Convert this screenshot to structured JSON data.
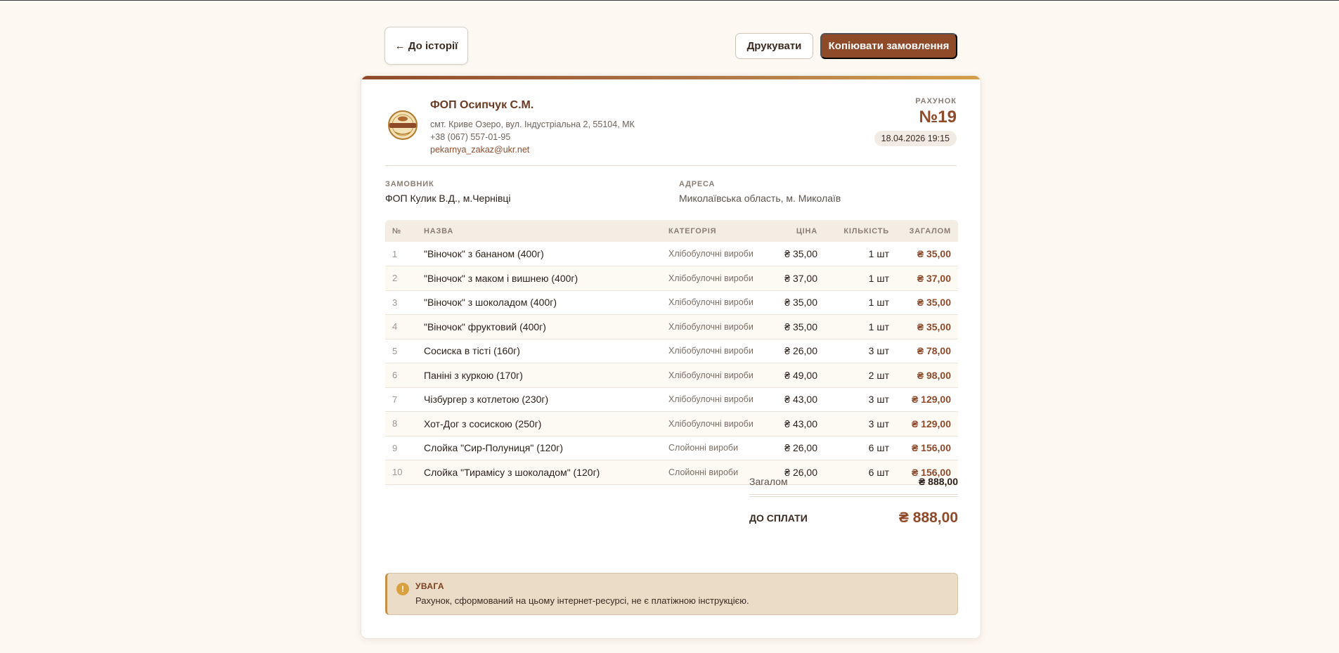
{
  "toolbar": {
    "back_label": "← До історії",
    "print_label": "Друкувати",
    "copy_label": "Копіювати замовлення"
  },
  "seller": {
    "name": "ФОП Осипчук С.М.",
    "address": "смт. Криве Озеро, вул. Індустріальна 2, 55104, МК",
    "phone": "+38 (067) 557-01-95",
    "email": "pekarnya_zakaz@ukr.net"
  },
  "invoice": {
    "label": "РАХУНОК",
    "number": "№19",
    "date": "18.04.2026 19:15"
  },
  "customer": {
    "label": "ЗАМОВНИК",
    "value": "ФОП Кулик В.Д., м.Чернівці"
  },
  "address": {
    "label": "АДРЕСА",
    "value": "Миколаївська область, м. Миколаїв"
  },
  "table": {
    "headers": {
      "num": "№",
      "name": "НАЗВА",
      "category": "КАТЕГОРІЯ",
      "price": "ЦІНА",
      "qty": "КІЛЬКІСТЬ",
      "total": "ЗАГАЛОМ"
    },
    "rows": [
      {
        "num": "1",
        "name": "\"Віночок\" з бананом (400г)",
        "category": "Хлібобулочні вироби",
        "price": "₴ 35,00",
        "qty": "1 шт",
        "total": "₴ 35,00"
      },
      {
        "num": "2",
        "name": "\"Віночок\" з маком і вишнею (400г)",
        "category": "Хлібобулочні вироби",
        "price": "₴ 37,00",
        "qty": "1 шт",
        "total": "₴ 37,00"
      },
      {
        "num": "3",
        "name": "\"Віночок\" з шоколадом (400г)",
        "category": "Хлібобулочні вироби",
        "price": "₴ 35,00",
        "qty": "1 шт",
        "total": "₴ 35,00"
      },
      {
        "num": "4",
        "name": "\"Віночок\" фруктовий (400г)",
        "category": "Хлібобулочні вироби",
        "price": "₴ 35,00",
        "qty": "1 шт",
        "total": "₴ 35,00"
      },
      {
        "num": "5",
        "name": "Сосиска в тісті (160г)",
        "category": "Хлібобулочні вироби",
        "price": "₴ 26,00",
        "qty": "3 шт",
        "total": "₴ 78,00"
      },
      {
        "num": "6",
        "name": "Паніні з куркою (170г)",
        "category": "Хлібобулочні вироби",
        "price": "₴ 49,00",
        "qty": "2 шт",
        "total": "₴ 98,00"
      },
      {
        "num": "7",
        "name": "Чізбургер з котлетою (230г)",
        "category": "Хлібобулочні вироби",
        "price": "₴ 43,00",
        "qty": "3 шт",
        "total": "₴ 129,00"
      },
      {
        "num": "8",
        "name": "Хот-Дог з сосискою (250г)",
        "category": "Хлібобулочні вироби",
        "price": "₴ 43,00",
        "qty": "3 шт",
        "total": "₴ 129,00"
      },
      {
        "num": "9",
        "name": "Слойка \"Сир-Полуниця\" (120г)",
        "category": "Слойонні вироби",
        "price": "₴ 26,00",
        "qty": "6 шт",
        "total": "₴ 156,00"
      },
      {
        "num": "10",
        "name": "Слойка \"Тирамісу з шоколадом\" (120г)",
        "category": "Слойонні вироби",
        "price": "₴ 26,00",
        "qty": "6 шт",
        "total": "₴ 156,00"
      }
    ]
  },
  "totals": {
    "subtotal_label": "Загалом",
    "subtotal_value": "₴ 888,00",
    "due_label": "ДО СПЛАТИ",
    "due_value": "₴ 888,00"
  },
  "warning": {
    "icon": "!",
    "title": "УВАГА",
    "text": "Рахунок, сформований на цьому інтернет-ресурсі, не є платіжною інструкцією."
  },
  "colors": {
    "accent": "#8f4a2a",
    "background": "#fdf8f2",
    "warning_bg": "#ebdcc8"
  }
}
